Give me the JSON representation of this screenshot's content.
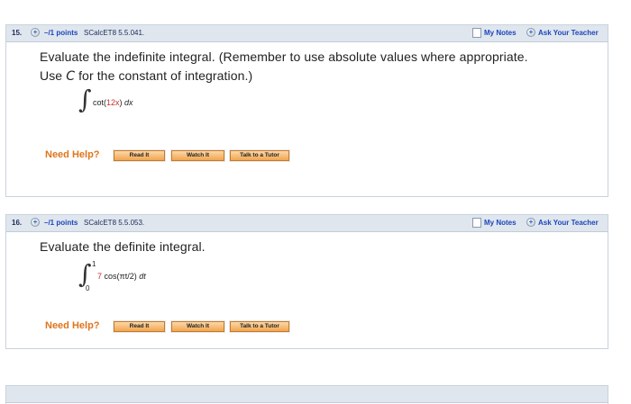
{
  "questions": [
    {
      "number": "15.",
      "points": "–/1 points",
      "source": "SCalcET8 5.5.041.",
      "my_notes": "My Notes",
      "ask_teacher": "Ask Your Teacher",
      "prompt_part1": "Evaluate the indefinite integral. (Remember to use absolute values where appropriate. Use ",
      "prompt_var": "C",
      "prompt_part2": " for the constant of integration.)",
      "expr_func": "cot(",
      "expr_inner": "12x",
      "expr_close": ")",
      "expr_dx": "dx",
      "need_help": "Need Help?",
      "btn_read": "Read It",
      "btn_watch": "Watch It",
      "btn_tutor": "Talk to a Tutor"
    },
    {
      "number": "16.",
      "points": "–/1 points",
      "source": "SCalcET8 5.5.053.",
      "my_notes": "My Notes",
      "ask_teacher": "Ask Your Teacher",
      "prompt": "Evaluate the definite integral.",
      "upper_limit": "1",
      "lower_limit": "0",
      "expr_coef": "7",
      "expr_func": "cos(πt/2)",
      "expr_dt": "dt",
      "need_help": "Need Help?",
      "btn_read": "Read It",
      "btn_watch": "Watch It",
      "btn_tutor": "Talk to a Tutor"
    }
  ],
  "icons": {
    "expand": "plus-circle-icon",
    "notes": "notes-icon",
    "ask": "plus-circle-icon"
  }
}
